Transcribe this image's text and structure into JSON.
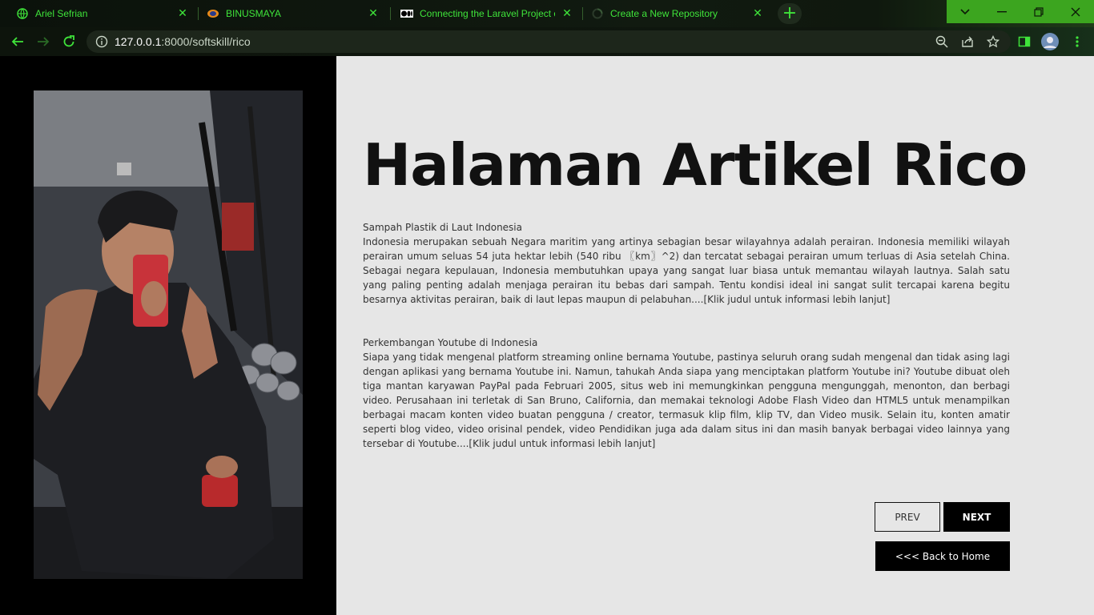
{
  "browser": {
    "tabs": [
      {
        "title": "Ariel Sefrian",
        "icon": "globe-icon"
      },
      {
        "title": "BINUSMAYA",
        "icon": "binus-logo-icon"
      },
      {
        "title": "Connecting the Laravel Project o",
        "icon": "medium-logo-icon"
      },
      {
        "title": "Create a New Repository",
        "icon": "loading-icon"
      }
    ],
    "url_host": "127.0.0.1",
    "url_path": ":8000/softskill/rico",
    "accent_color": "#3fe43a"
  },
  "page": {
    "heading": "Halaman Artikel Rico",
    "articles": [
      {
        "title": "Sampah Plastik di Laut Indonesia",
        "body": "Indonesia merupakan sebuah Negara maritim yang artinya sebagian besar wilayahnya adalah perairan. Indonesia memiliki wilayah perairan umum seluas 54 juta hektar lebih (540 ribu 〖km〗^2) dan tercatat sebagai perairan umum terluas di Asia setelah China. Sebagai negara kepulauan, Indonesia membutuhkan upaya yang sangat luar biasa untuk memantau wilayah lautnya. Salah satu yang paling penting adalah menjaga perairan itu bebas dari sampah. Tentu kondisi ideal ini sangat sulit tercapai karena begitu besarnya aktivitas perairan, baik di laut lepas maupun di pelabuhan....[Klik judul untuk informasi lebih lanjut]"
      },
      {
        "title": "Perkembangan Youtube di Indonesia",
        "body": "Siapa yang tidak mengenal platform streaming online bernama Youtube, pastinya seluruh orang sudah mengenal dan tidak asing lagi dengan aplikasi yang bernama Youtube ini. Namun, tahukah Anda siapa yang menciptakan platform Youtube ini? Youtube dibuat oleh tiga mantan karyawan PayPal pada Februari 2005, situs web ini memungkinkan pengguna mengunggah, menonton, dan berbagi video. Perusahaan ini terletak di San Bruno, California, dan memakai teknologi Adobe Flash Video dan HTML5 untuk menampilkan berbagai macam konten video buatan pengguna / creator, termasuk klip film, klip TV, dan Video musik. Selain itu, konten amatir seperti blog video, video orisinal pendek, video Pendidikan juga ada dalam situs ini dan masih banyak berbagai video lainnya yang tersebar di Youtube....[Klik judul untuk informasi lebih lanjut]"
      }
    ],
    "prev_label": "PREV",
    "next_label": "NEXT",
    "home_label": "<<< Back to Home"
  }
}
